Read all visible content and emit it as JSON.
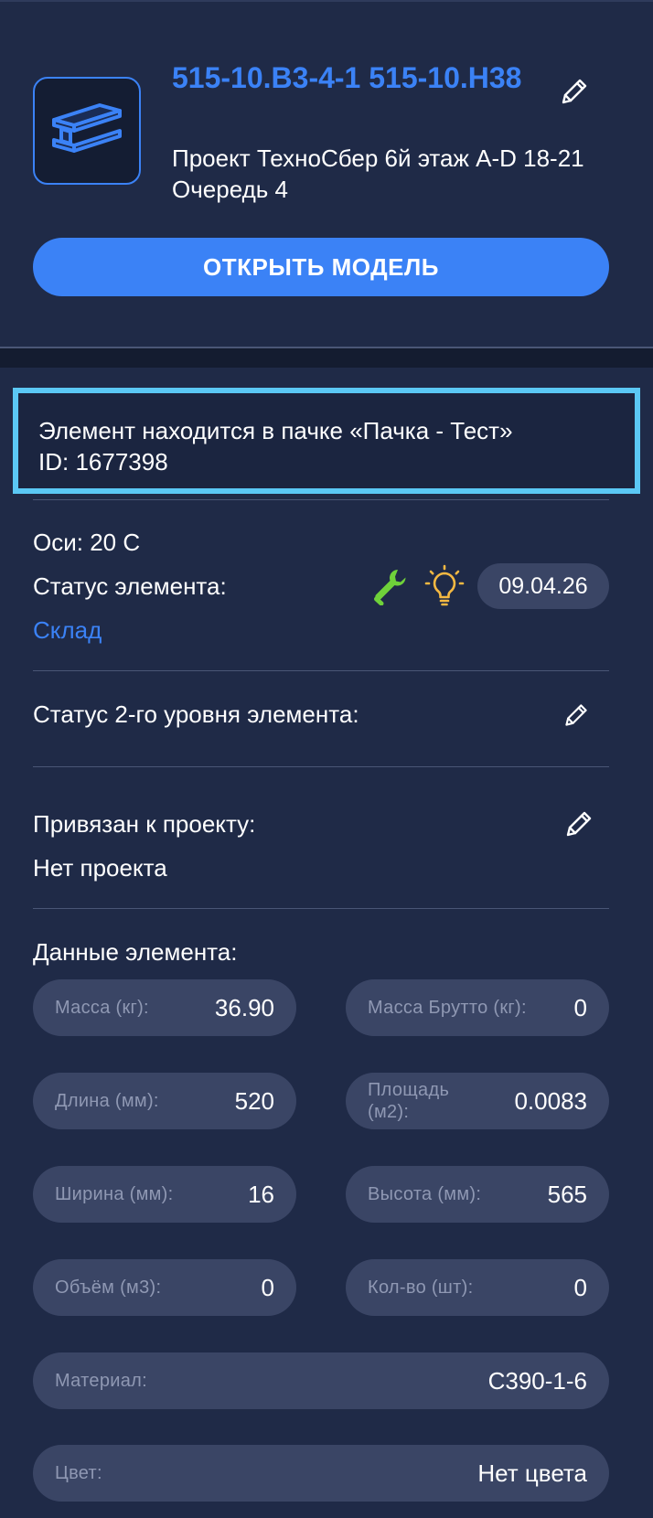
{
  "header": {
    "title": "515-10.В3-4-1 515-10.Н38",
    "subtitle": "Проект ТехноСбер 6й этаж A-D 18-21 Очередь 4",
    "open_model_label": "ОТКРЫТЬ МОДЕЛЬ",
    "thumbnail_icon": "i-beam-icon",
    "edit_icon": "pencil-icon"
  },
  "notice": {
    "line1": "Элемент находится в пачке «Пачка - Тест»",
    "line2": "ID: 1677398"
  },
  "element": {
    "axes": "Оси: 20 С",
    "status_label": "Статус элемента:",
    "status_value": "Склад",
    "status_icons": [
      "wrench-icon",
      "lightbulb-icon"
    ],
    "status_date": "09.04.26",
    "status2_label": "Статус 2-го уровня элемента:",
    "project_label": "Привязан к проекту:",
    "project_value": "Нет проекта"
  },
  "data_section": {
    "title": "Данные элемента:",
    "fields": [
      {
        "label": "Масса (кг):",
        "value": "36.90"
      },
      {
        "label": "Масса Брутто (кг):",
        "value": "0"
      },
      {
        "label": "Длина (мм):",
        "value": "520"
      },
      {
        "label": "Площадь (м2):",
        "value": "0.0083"
      },
      {
        "label": "Ширина (мм):",
        "value": "16"
      },
      {
        "label": "Высота (мм):",
        "value": "565"
      },
      {
        "label": "Объём (м3):",
        "value": "0"
      },
      {
        "label": "Кол-во (шт):",
        "value": "0"
      }
    ],
    "material": {
      "label": "Материал:",
      "value": "С390-1-6"
    },
    "color": {
      "label": "Цвет:",
      "value": "Нет цвета"
    }
  },
  "colors": {
    "background": "#1f2a47",
    "accent": "#3b82f6",
    "pill": "#3a4565",
    "highlight_border": "#5bc8f5",
    "wrench": "#6fd13a",
    "bulb": "#f5b942"
  }
}
